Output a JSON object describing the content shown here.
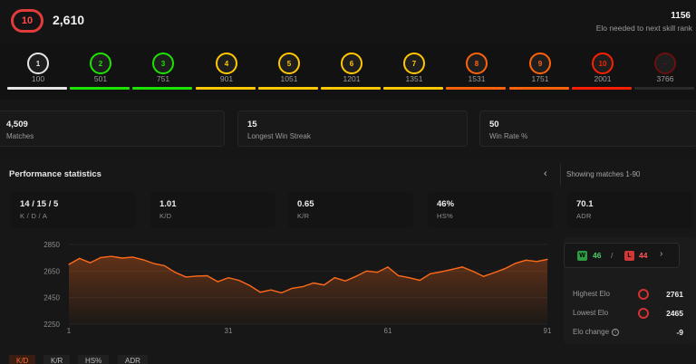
{
  "header": {
    "level": "10",
    "elo": "2,610",
    "elo_needed": "1156",
    "elo_needed_label": "Elo needed to next skill rank"
  },
  "levels": [
    {
      "num": "1",
      "elo": "100",
      "color": "#e6e6e6"
    },
    {
      "num": "2",
      "elo": "501",
      "color": "#1ce400"
    },
    {
      "num": "3",
      "elo": "751",
      "color": "#1ce400"
    },
    {
      "num": "4",
      "elo": "901",
      "color": "#ffc800"
    },
    {
      "num": "5",
      "elo": "1051",
      "color": "#ffc800"
    },
    {
      "num": "6",
      "elo": "1201",
      "color": "#ffc800"
    },
    {
      "num": "7",
      "elo": "1351",
      "color": "#ffc800"
    },
    {
      "num": "8",
      "elo": "1531",
      "color": "#ff6309"
    },
    {
      "num": "9",
      "elo": "1751",
      "color": "#ff6309"
    },
    {
      "num": "10",
      "elo": "2001",
      "color": "#fe1f00"
    },
    {
      "num": "–",
      "elo": "3766",
      "color": "#6b1010"
    }
  ],
  "summary": {
    "matches_value": "4,509",
    "matches_label": "Matches",
    "streak_value": "15",
    "streak_label": "Longest Win Streak",
    "winrate_value": "50",
    "winrate_label": "Win Rate %"
  },
  "performance": {
    "title": "Performance statistics",
    "showing": "Showing matches 1-90",
    "stats": [
      {
        "value": "14 / 15 / 5",
        "label": "K / D / A"
      },
      {
        "value": "1.01",
        "label": "K/D"
      },
      {
        "value": "0.65",
        "label": "K/R"
      },
      {
        "value": "46%",
        "label": "HS%"
      },
      {
        "value": "70.1",
        "label": "ADR"
      }
    ]
  },
  "side": {
    "wins": "46",
    "losses": "44",
    "win_icon": "W",
    "loss_icon": "L",
    "highest_label": "Highest Elo",
    "highest_value": "2761",
    "lowest_label": "Lowest Elo",
    "lowest_value": "2465",
    "change_label": "Elo change",
    "change_value": "-9"
  },
  "tabs": [
    "K/D",
    "K/R",
    "HS%",
    "ADR"
  ],
  "chart_data": {
    "type": "area",
    "ylim": [
      2250,
      2850
    ],
    "yticks": [
      2850,
      2650,
      2450,
      2250
    ],
    "xticks": [
      1,
      31,
      61,
      91
    ],
    "x": [
      1,
      3,
      5,
      7,
      9,
      11,
      13,
      15,
      17,
      19,
      21,
      23,
      25,
      27,
      29,
      31,
      33,
      35,
      37,
      39,
      41,
      43,
      45,
      47,
      49,
      51,
      53,
      55,
      57,
      59,
      61,
      63,
      65,
      67,
      69,
      71,
      73,
      75,
      77,
      79,
      81,
      83,
      85,
      87,
      89,
      91
    ],
    "values": [
      2700,
      2745,
      2712,
      2752,
      2761,
      2748,
      2755,
      2735,
      2706,
      2690,
      2640,
      2605,
      2612,
      2615,
      2570,
      2600,
      2580,
      2541,
      2491,
      2508,
      2486,
      2520,
      2532,
      2560,
      2545,
      2600,
      2575,
      2610,
      2650,
      2641,
      2680,
      2615,
      2600,
      2580,
      2630,
      2644,
      2662,
      2680,
      2648,
      2610,
      2638,
      2668,
      2708,
      2732,
      2722,
      2738
    ]
  }
}
